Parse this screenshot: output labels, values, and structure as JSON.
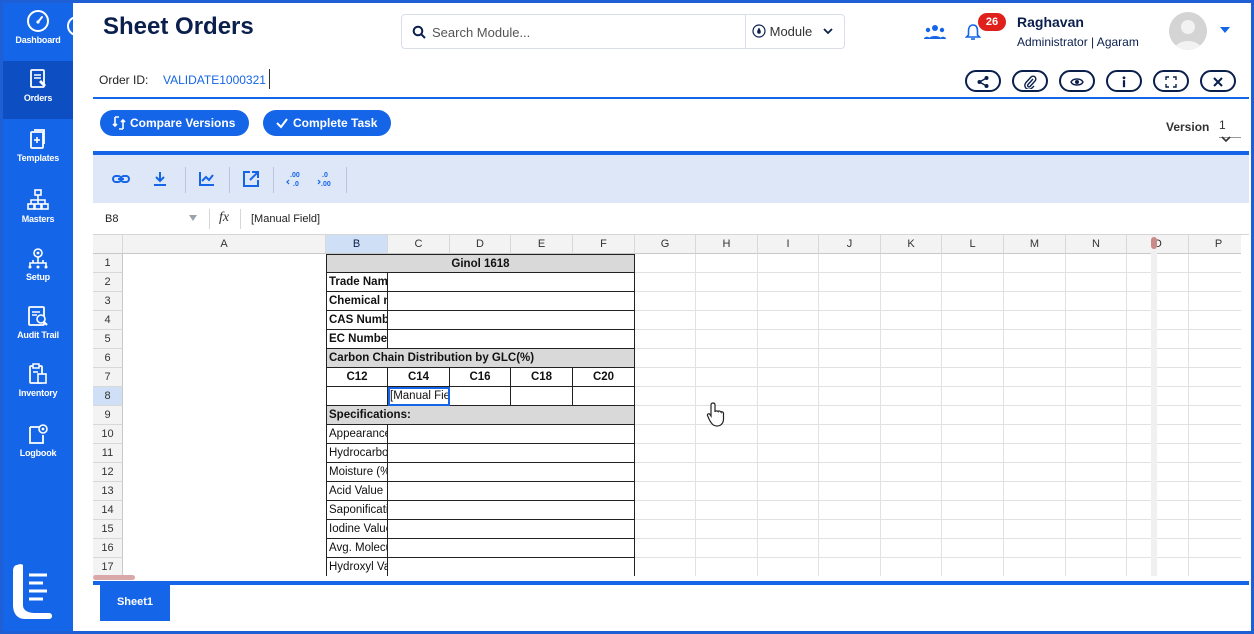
{
  "app": {
    "title": "Sheet Orders"
  },
  "sidebar": {
    "items": [
      {
        "label": "Dashboard",
        "icon": "gauge-icon"
      },
      {
        "label": "Orders",
        "icon": "orders-icon"
      },
      {
        "label": "Templates",
        "icon": "templates-icon"
      },
      {
        "label": "Masters",
        "icon": "hierarchy-icon"
      },
      {
        "label": "Setup",
        "icon": "setup-icon"
      },
      {
        "label": "Audit Trail",
        "icon": "audit-icon"
      },
      {
        "label": "Inventory",
        "icon": "inventory-icon"
      },
      {
        "label": "Logbook",
        "icon": "logbook-icon"
      }
    ],
    "active": "Orders"
  },
  "header": {
    "search_placeholder": "Search Module...",
    "module_label": "Module",
    "notification_count": "26",
    "user_name": "Raghavan",
    "user_role": "Administrator | Agaram"
  },
  "order": {
    "label": "Order ID:",
    "value": "VALIDATE1000321"
  },
  "actions": {
    "compare_label": "Compare Versions",
    "complete_label": "Complete Task",
    "version_label": "Version",
    "version_value": "1"
  },
  "formula": {
    "cell_ref": "B8",
    "fx": "fx",
    "value": "[Manual Field]"
  },
  "grid": {
    "columns": [
      "A",
      "B",
      "C",
      "D",
      "E",
      "F",
      "G",
      "H",
      "I",
      "J",
      "K",
      "L",
      "M",
      "N",
      "O",
      "P"
    ],
    "rows": [
      {
        "n": "1",
        "a": "Ginol 1618"
      },
      {
        "n": "2",
        "a": "Trade Name"
      },
      {
        "n": "3",
        "a": "Chemical name"
      },
      {
        "n": "4",
        "a": "CAS Number"
      },
      {
        "n": "5",
        "a": "EC Number"
      },
      {
        "n": "6",
        "a": "Carbon Chain Distribution by GLC(%)"
      },
      {
        "n": "7",
        "a": "C12",
        "b": "C14",
        "c": "C16",
        "d": "C18",
        "e": "C20"
      },
      {
        "n": "8",
        "a": "",
        "b": "[Manual Field]"
      },
      {
        "n": "9",
        "a": "Specifications:"
      },
      {
        "n": "10",
        "a": "Appearance"
      },
      {
        "n": "11",
        "a": "Hydrocarbons(% By WT)"
      },
      {
        "n": "12",
        "a": "Moisture (% By WT)"
      },
      {
        "n": "13",
        "a": "Acid Value"
      },
      {
        "n": "14",
        "a": "Saponification Value"
      },
      {
        "n": "15",
        "a": "Iodine Value"
      },
      {
        "n": "16",
        "a": "Avg. Molecular Weight"
      },
      {
        "n": "17",
        "a": "Hydroxyl Value"
      }
    ]
  },
  "sheet": {
    "tab_label": "Sheet1"
  },
  "colors": {
    "primary": "#1565e8",
    "dark_text": "#0b1f4d",
    "badge": "#e0201b"
  }
}
